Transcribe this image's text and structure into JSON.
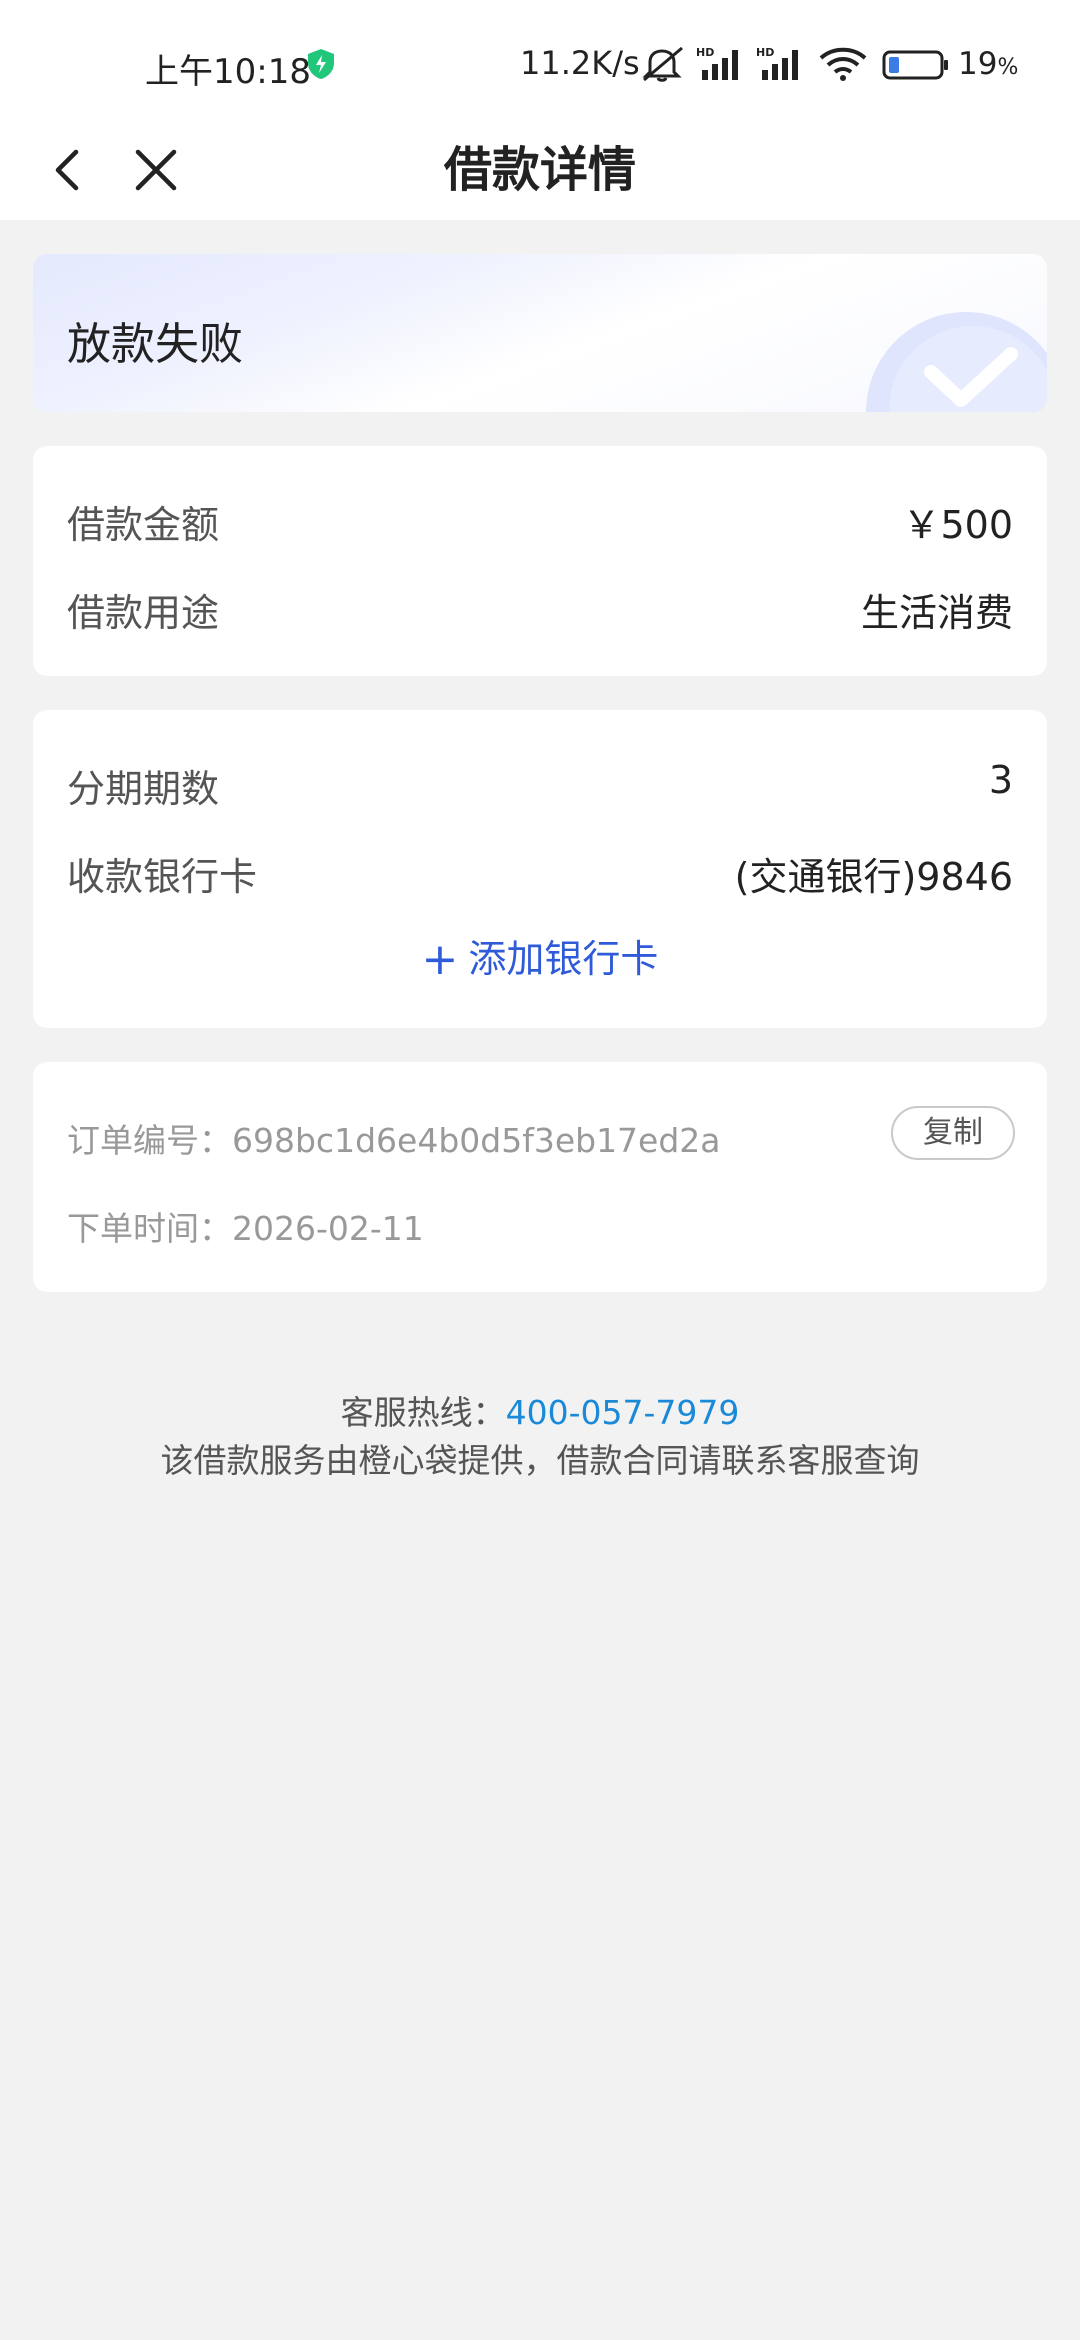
{
  "status_bar": {
    "time": "上午10:18",
    "net_speed": "11.2K/s",
    "battery": "19"
  },
  "nav": {
    "title": "借款详情"
  },
  "status_card": {
    "text": "放款失败"
  },
  "amount_card": {
    "amount_label": "借款金额",
    "amount_value": "￥500",
    "purpose_label": "借款用途",
    "purpose_value": "生活消费"
  },
  "install_card": {
    "periods_label": "分期期数",
    "periods_value": "3",
    "bank_label": "收款银行卡",
    "bank_value": "(交通银行)9846",
    "add_card_label": "添加银行卡"
  },
  "order_card": {
    "order_no_label": "订单编号：",
    "order_no_value": "698bc1d6e4b0d5f3eb17ed2a",
    "copy_label": "复制",
    "order_time_label": "下单时间：",
    "order_time_value": "2026-02-11"
  },
  "footer": {
    "hotline_label": "客服热线：",
    "hotline_number": "400-057-7979",
    "note": "该借款服务由橙心袋提供，借款合同请联系客服查询"
  },
  "colors": {
    "accent_link": "#2f5bd8",
    "hotline": "#1a8ad8",
    "shield": "#20c77a"
  }
}
